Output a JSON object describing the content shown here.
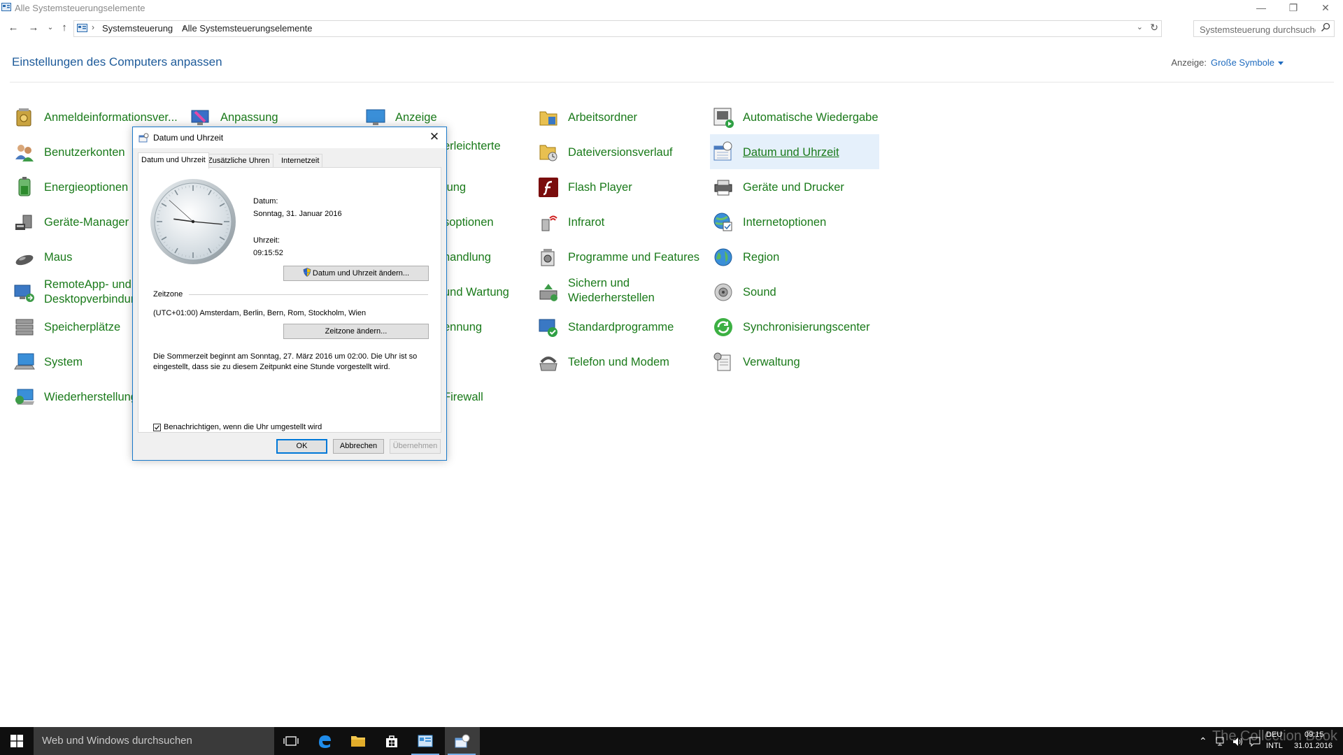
{
  "window": {
    "title": "Alle Systemsteuerungselemente",
    "min_glyph": "—",
    "max_glyph": "❐",
    "close_glyph": "✕"
  },
  "address": {
    "crumbs": [
      "Systemsteuerung",
      "Alle Systemsteuerungselemente"
    ],
    "search_placeholder": "Systemsteuerung durchsuchen"
  },
  "page": {
    "heading": "Einstellungen des Computers anpassen",
    "view_label": "Anzeige:",
    "view_value": "Große Symbole"
  },
  "items": [
    {
      "label": "Anmeldeinformationsver...",
      "icon": "credential-vault-icon"
    },
    {
      "label": "Benutzerkonten",
      "icon": "users-icon"
    },
    {
      "label": "Energieoptionen",
      "icon": "power-options-icon"
    },
    {
      "label": "Geräte-Manager",
      "icon": "device-manager-icon"
    },
    {
      "label": "Maus",
      "icon": "mouse-icon"
    },
    {
      "label": "RemoteApp- und Desktopverbindun",
      "icon": "remoteapp-icon"
    },
    {
      "label": "Speicherplätze",
      "icon": "storage-spaces-icon"
    },
    {
      "label": "System",
      "icon": "system-icon"
    },
    {
      "label": "Wiederherstellung",
      "icon": "recovery-icon"
    },
    {
      "label": "Anpassung",
      "icon": "personalization-icon"
    },
    {
      "label": "Anzeige",
      "icon": "display-icon"
    },
    {
      "label": "erleichterte",
      "icon": "ease-of-access-icon"
    },
    {
      "label": "tung",
      "icon": ""
    },
    {
      "label": "soptionen",
      "icon": ""
    },
    {
      "label": "handlung",
      "icon": ""
    },
    {
      "label": "und Wartung",
      "icon": ""
    },
    {
      "label": "ennung",
      "icon": ""
    },
    {
      "label": "Firewall",
      "icon": ""
    },
    {
      "label": "Arbeitsordner",
      "icon": "work-folders-icon"
    },
    {
      "label": "Dateiversionsverlauf",
      "icon": "file-history-icon"
    },
    {
      "label": "Flash Player",
      "icon": "flash-player-icon"
    },
    {
      "label": "Infrarot",
      "icon": "infrared-icon"
    },
    {
      "label": "Programme und Features",
      "icon": "programs-icon"
    },
    {
      "label": "Sichern und Wiederherstellen",
      "icon": "backup-icon"
    },
    {
      "label": "Standardprogramme",
      "icon": "default-programs-icon"
    },
    {
      "label": "Telefon und Modem",
      "icon": "phone-modem-icon"
    },
    {
      "label": "Automatische Wiedergabe",
      "icon": "autoplay-icon"
    },
    {
      "label": "Datum und Uhrzeit",
      "icon": "date-time-icon"
    },
    {
      "label": "Geräte und Drucker",
      "icon": "devices-printers-icon"
    },
    {
      "label": "Internetoptionen",
      "icon": "internet-options-icon"
    },
    {
      "label": "Region",
      "icon": "region-icon"
    },
    {
      "label": "Sound",
      "icon": "sound-icon"
    },
    {
      "label": "Synchronisierungscenter",
      "icon": "sync-center-icon"
    },
    {
      "label": "Verwaltung",
      "icon": "administrative-tools-icon"
    }
  ],
  "dialog": {
    "title": "Datum und Uhrzeit",
    "tabs": [
      "Datum und Uhrzeit",
      "Zusätzliche Uhren",
      "Internetzeit"
    ],
    "date_label": "Datum:",
    "date_value": "Sonntag, 31. Januar 2016",
    "time_label": "Uhrzeit:",
    "time_value": "09:15:52",
    "clock": {
      "hours": 9,
      "minutes": 15,
      "seconds": 52
    },
    "change_datetime_button": "Datum und Uhrzeit ändern...",
    "timezone_heading": "Zeitzone",
    "timezone_value": "(UTC+01:00) Amsterdam, Berlin, Bern, Rom, Stockholm, Wien",
    "change_timezone_button": "Zeitzone ändern...",
    "dst_note": "Die Sommerzeit beginnt am Sonntag, 27. März 2016 um 02:00. Die Uhr ist so eingestellt, dass sie zu diesem Zeitpunkt eine Stunde vorgestellt wird.",
    "notify_checkbox_label": "Benachrichtigen, wenn die Uhr umgestellt wird",
    "notify_checked": true,
    "ok": "OK",
    "cancel": "Abbrechen",
    "apply": "Übernehmen"
  },
  "taskbar": {
    "search_placeholder": "Web und Windows durchsuchen",
    "lang_top": "DEU",
    "lang_bottom": "INTL",
    "time": "09:15",
    "date": "31.01.2016",
    "watermark": "The Collection Book"
  }
}
